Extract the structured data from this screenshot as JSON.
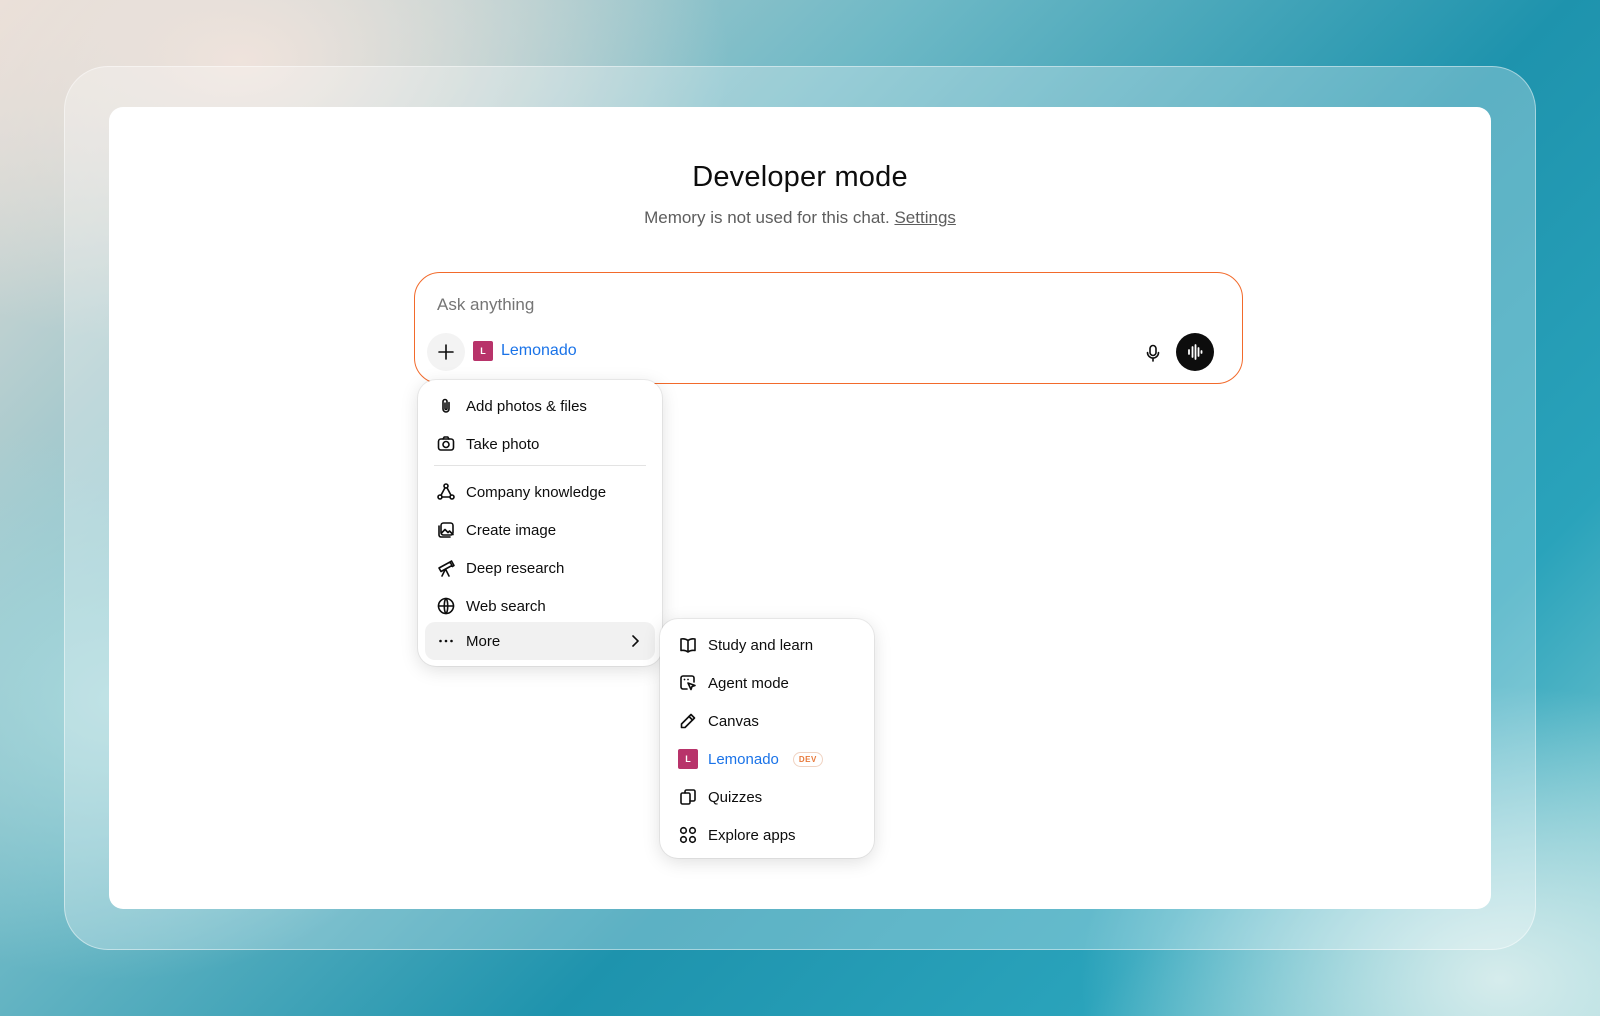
{
  "header": {
    "title": "Developer mode",
    "subtitle": "Memory is not used for this chat.",
    "settings_link": "Settings"
  },
  "composer": {
    "placeholder": "Ask anything",
    "app_chip": {
      "logo_letter": "L",
      "label": "Lemonado"
    }
  },
  "menu": {
    "items": [
      {
        "label": "Add photos & files",
        "icon": "paperclip-icon"
      },
      {
        "label": "Take photo",
        "icon": "camera-icon"
      },
      {
        "label": "Company knowledge",
        "icon": "network-icon"
      },
      {
        "label": "Create image",
        "icon": "image-icon"
      },
      {
        "label": "Deep research",
        "icon": "telescope-icon"
      },
      {
        "label": "Web search",
        "icon": "globe-icon"
      },
      {
        "label": "More",
        "icon": "more-dots-icon"
      }
    ]
  },
  "submenu": {
    "items": [
      {
        "label": "Study and learn",
        "icon": "book-icon"
      },
      {
        "label": "Agent mode",
        "icon": "agent-cursor-icon"
      },
      {
        "label": "Canvas",
        "icon": "pencil-icon"
      },
      {
        "label": "Lemonado",
        "icon": "lemonado-logo",
        "logo_letter": "L",
        "badge": "DEV"
      },
      {
        "label": "Quizzes",
        "icon": "cards-icon"
      },
      {
        "label": "Explore apps",
        "icon": "apps-grid-icon"
      }
    ]
  },
  "colors": {
    "accent_border": "#f26a2b",
    "link_blue": "#1a73e8",
    "lemonado_brand": "#b8336a",
    "dev_badge": "#e8793a"
  }
}
